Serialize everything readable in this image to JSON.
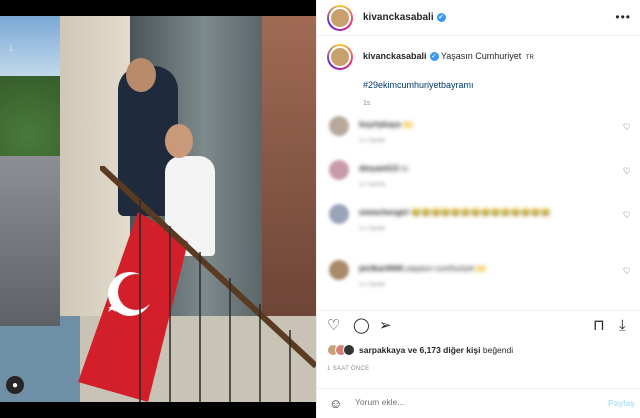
{
  "header": {
    "username": "kivanckasabali",
    "more_label": "•••"
  },
  "caption": {
    "username": "kivanckasabali",
    "text": "Yaşasın Cumhuriyet",
    "flag_text": "TR",
    "hashtag": "#29ekimcumhuriyetbayramı",
    "time": "1s"
  },
  "comments": [
    {
      "user": "bsyrtykaya",
      "text": "🙌",
      "meta": "1s  Yanıtla"
    },
    {
      "user": "dmyanti13",
      "text": "ru",
      "meta": "1s  Yanıtla"
    },
    {
      "user": "emmchengirl",
      "text": "😂😂😂😂😂😂😂😂😂😂😂😂😂😂",
      "meta": "1s  Yanıtla"
    },
    {
      "user": "pictkar4444",
      "text": "yaşasın cumhuriyet 🙌",
      "meta": "1s  Yanıtla"
    }
  ],
  "likes": {
    "first_user": "sarpakkaya",
    "rest": "ve 6,173 diğer kişi",
    "suffix": "beğendi"
  },
  "post_time": "1 SAAT ÖNCE",
  "add_comment": {
    "placeholder": "Yorum ekle...",
    "post_label": "Paylaş"
  },
  "icons": {
    "verified": "verified-badge-icon",
    "tag": "user-tag-icon"
  },
  "colors": {
    "link": "#00376b",
    "verified": "#3897f0",
    "post_disabled": "#b2dffc"
  }
}
